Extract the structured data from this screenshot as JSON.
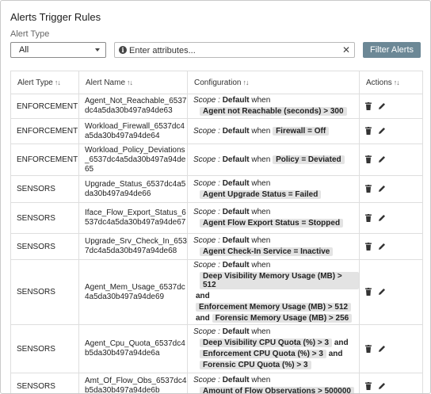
{
  "page": {
    "title": "Alerts Trigger Rules",
    "alert_type_label": "Alert Type",
    "alert_type_value": "All",
    "search_placeholder": "Enter attributes...",
    "filter_button": "Filter Alerts"
  },
  "table": {
    "headers": [
      "Alert Type",
      "Alert Name",
      "Configuration",
      "Actions"
    ],
    "scope_label": "Scope :",
    "scope_value": "Default",
    "when_text": "when",
    "rows": [
      {
        "type": "ENFORCEMENT",
        "name": "Agent_Not_Reachable_6537dc4a5da30b497a94de63",
        "conditions": [
          "Agent not Reachable (seconds) > 300"
        ],
        "inline": false
      },
      {
        "type": "ENFORCEMENT",
        "name": "Workload_Firewall_6537dc4a5da30b497a94de64",
        "conditions": [
          "Firewall = Off"
        ],
        "inline": true
      },
      {
        "type": "ENFORCEMENT",
        "name": "Workload_Policy_Deviations_6537dc4a5da30b497a94de65",
        "conditions": [
          "Policy = Deviated"
        ],
        "inline": true
      },
      {
        "type": "SENSORS",
        "name": "Upgrade_Status_6537dc4a5da30b497a94de66",
        "conditions": [
          "Agent Upgrade Status = Failed"
        ],
        "inline": false
      },
      {
        "type": "SENSORS",
        "name": "Iface_Flow_Export_Status_6537dc4a5da30b497a94de67",
        "conditions": [
          "Agent Flow Export Status = Stopped"
        ],
        "inline": false
      },
      {
        "type": "SENSORS",
        "name": "Upgrade_Srv_Check_In_6537dc4a5da30b497a94de68",
        "conditions": [
          "Agent Check-In Service = Inactive"
        ],
        "inline": false
      },
      {
        "type": "SENSORS",
        "name": "Agent_Mem_Usage_6537dc4a5da30b497a94de69",
        "conditions": [
          "Deep Visibility Memory Usage (MB) > 512",
          "Enforcement Memory Usage (MB) > 512",
          "Forensic Memory Usage (MB) > 256"
        ],
        "inline": false
      },
      {
        "type": "SENSORS",
        "name": "Agent_Cpu_Quota_6537dc4b5da30b497a94de6a",
        "conditions": [
          "Deep Visibility CPU Quota (%) > 3",
          "Enforcement CPU Quota (%) > 3",
          "Forensic CPU Quota (%) > 3"
        ],
        "inline": false
      },
      {
        "type": "SENSORS",
        "name": "Amt_Of_Flow_Obs_6537dc4b5da30b497a94de6b",
        "conditions": [
          "Amount of Flow Observations > 500000"
        ],
        "inline": false
      }
    ],
    "and_text": "and"
  },
  "icons": {
    "delete": "trash-icon",
    "edit": "pencil-icon",
    "info": "info-icon",
    "clear": "close-icon",
    "sort": "sort-icon",
    "dropdown": "chevron-down-icon"
  }
}
